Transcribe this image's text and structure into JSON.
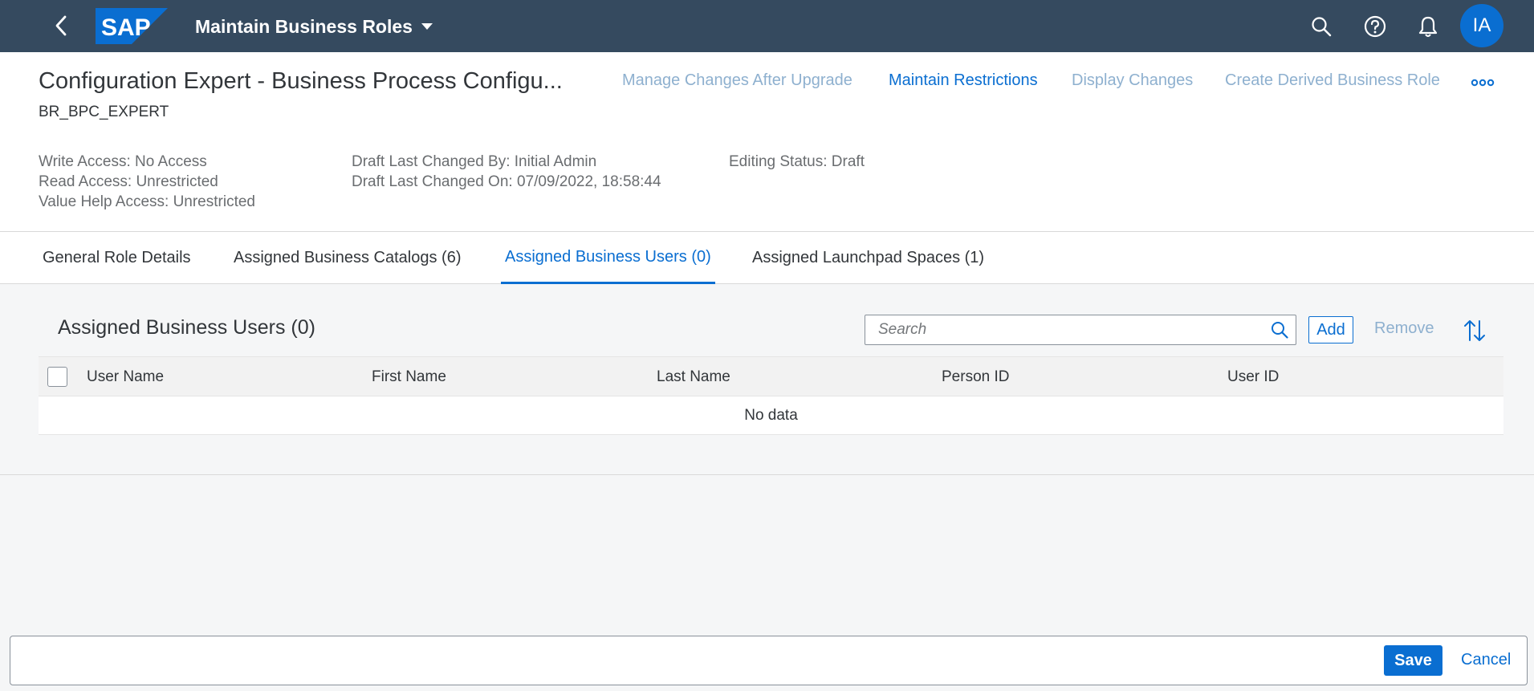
{
  "shell": {
    "logo_text": "SAP",
    "app_title": "Maintain Business Roles",
    "avatar_initials": "IA",
    "icons": [
      "back-icon",
      "dropdown-icon",
      "search-icon",
      "help-icon",
      "notification-bell-icon"
    ],
    "bg_color": "#354a5f",
    "logo_color": "#0a6ed1"
  },
  "header": {
    "title": "Configuration Expert - Business Process Configu...",
    "subtitle": "BR_BPC_EXPERT",
    "actions": {
      "manage_changes": "Manage Changes After Upgrade",
      "maintain_restrictions": "Maintain Restrictions",
      "display_changes": "Display Changes",
      "create_derived": "Create Derived Business Role"
    },
    "attributes": {
      "write_access": "Write Access: No Access",
      "read_access": "Read Access: Unrestricted",
      "value_help_access": "Value Help Access: Unrestricted",
      "draft_changed_by": "Draft Last Changed By: Initial Admin",
      "draft_changed_on": "Draft Last Changed On: 07/09/2022, 18:58:44",
      "editing_status": "Editing Status: Draft"
    }
  },
  "tabs": [
    {
      "label": "General Role Details"
    },
    {
      "label": "Assigned Business Catalogs (6)"
    },
    {
      "label": "Assigned Business Users (0)",
      "active": true
    },
    {
      "label": "Assigned Launchpad Spaces (1)"
    }
  ],
  "section": {
    "title": "Assigned Business Users (0)",
    "search_placeholder": "Search",
    "add_label": "Add",
    "remove_label": "Remove"
  },
  "table": {
    "columns": [
      "User Name",
      "First Name",
      "Last Name",
      "Person ID",
      "User ID"
    ],
    "empty_text": "No data"
  },
  "footer": {
    "save_label": "Save",
    "cancel_label": "Cancel"
  },
  "colors": {
    "accent": "#0a6ed1",
    "disabled_link": "#8eb0cf"
  }
}
